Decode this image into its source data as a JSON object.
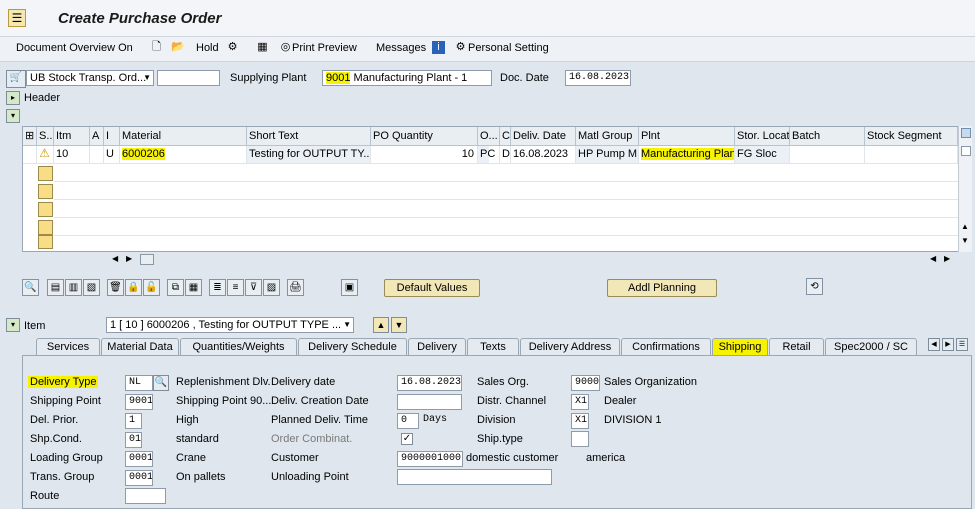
{
  "window": {
    "title": "Create Purchase Order"
  },
  "toolbar": {
    "document_overview": "Document Overview On",
    "hold": "Hold",
    "print_preview": "Print Preview",
    "messages": "Messages",
    "personal_setting": "Personal Setting"
  },
  "header": {
    "order_type": "UB Stock Transp. Ord...",
    "supplying_plant_label": "Supplying Plant",
    "supplying_plant_code": "9001",
    "supplying_plant_name": "Manufacturing Plant - 1",
    "doc_date_label": "Doc. Date",
    "doc_date": "16.08.2023",
    "header_label": "Header"
  },
  "items_table": {
    "columns": [
      "S..",
      "Itm",
      "A",
      "I",
      "Material",
      "Short Text",
      "PO Quantity",
      "O...",
      "C",
      "Deliv. Date",
      "Matl Group",
      "Plnt",
      "Stor. Location",
      "Batch",
      "Stock Segment"
    ],
    "rows": [
      {
        "itm": "10",
        "a": "",
        "i": "U",
        "material": "6000206",
        "short_text": "Testing for OUTPUT TY...",
        "po_qty": "10",
        "oun": "PC",
        "c": "D",
        "deliv_date": "16.08.2023",
        "matl_group": "HP Pump M...",
        "plnt": "Manufacturing Plan...",
        "stor_loc": "FG Sloc",
        "batch": "",
        "stock_segment": ""
      }
    ]
  },
  "buttons": {
    "default_values": "Default Values",
    "addl_planning": "Addl Planning"
  },
  "item": {
    "label": "Item",
    "selector": "1 [ 10 ] 6000206 , Testing for OUTPUT TYPE ..."
  },
  "tabs": [
    "Services",
    "Material Data",
    "Quantities/Weights",
    "Delivery Schedule",
    "Delivery",
    "Texts",
    "Delivery Address",
    "Confirmations",
    "Shipping",
    "Retail",
    "Spec2000 / SC"
  ],
  "active_tab": "Shipping",
  "shipping": {
    "delivery_type_label": "Delivery Type",
    "delivery_type": "NL",
    "replenishment_dlv": "Replenishment Dlv.",
    "delivery_date_label": "Delivery date",
    "delivery_date": "16.08.2023",
    "sales_org_label": "Sales Org.",
    "sales_org": "9000",
    "sales_org_text": "Sales Organization",
    "shipping_point_label": "Shipping Point",
    "shipping_point": "9001",
    "shipping_point_text": "Shipping Point 90...",
    "deliv_creation_date_label": "Deliv. Creation Date",
    "deliv_creation_date": "",
    "distr_channel_label": "Distr. Channel",
    "distr_channel": "X1",
    "distr_channel_text": "Dealer",
    "del_prior_label": "Del. Prior.",
    "del_prior": "1",
    "del_prior_text": "High",
    "planned_deliv_time_label": "Planned Deliv. Time",
    "planned_deliv_time": "0",
    "days": "Days",
    "division_label": "Division",
    "division": "X1",
    "division_text": "DIVISION 1",
    "shp_cond_label": "Shp.Cond.",
    "shp_cond": "01",
    "shp_cond_text": "standard",
    "order_combinat_label": "Order Combinat.",
    "order_combinat_checked": "✓",
    "ship_type_label": "Ship.type",
    "ship_type": "",
    "loading_group_label": "Loading Group",
    "loading_group": "0001",
    "loading_group_text": "Crane",
    "customer_label": "Customer",
    "customer": "9000001000",
    "customer_text": "domestic customer",
    "customer_city": "america",
    "trans_group_label": "Trans. Group",
    "trans_group": "0001",
    "trans_group_text": "On pallets",
    "unloading_point_label": "Unloading Point",
    "unloading_point": "",
    "route_label": "Route",
    "route": ""
  }
}
